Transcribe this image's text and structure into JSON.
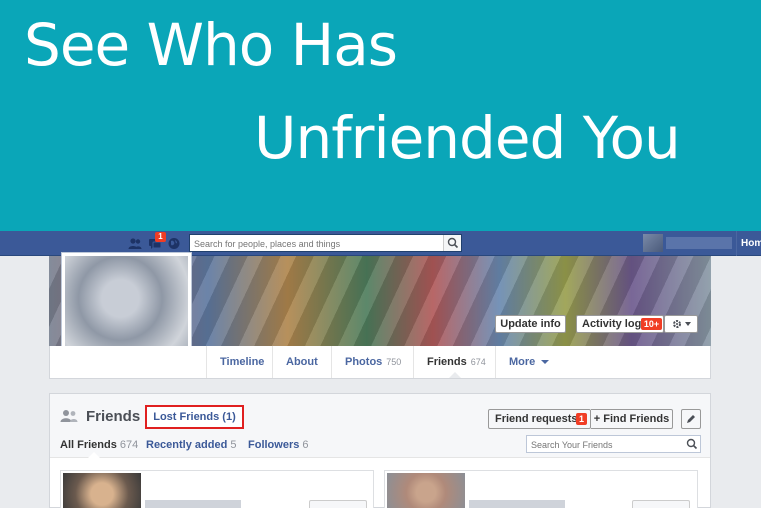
{
  "banner": {
    "line1": "See Who Has",
    "line2": "Unfriended You",
    "color": "#0aa6b8"
  },
  "topbar": {
    "color": "#3b5998",
    "icons": [
      "friend-requests-icon",
      "messages-icon",
      "notifications-globe-icon"
    ],
    "messages_badge": "1",
    "search_placeholder": "Search for people, places and things",
    "home_label": "Home"
  },
  "cover": {
    "update_info_label": "Update info",
    "activity_log_label": "Activity log",
    "activity_badge": "10+",
    "settings_icon": "gear-icon"
  },
  "profile_nav": {
    "tabs": [
      {
        "label": "Timeline",
        "count": ""
      },
      {
        "label": "About",
        "count": ""
      },
      {
        "label": "Photos",
        "count": "750"
      },
      {
        "label": "Friends",
        "count": "674"
      },
      {
        "label": "More",
        "count": ""
      }
    ]
  },
  "friends": {
    "title": "Friends",
    "lost_friends_label": "Lost Friends (1)",
    "friend_requests_label": "Friend requests",
    "friend_requests_badge": "1",
    "find_friends_label": "+ Find Friends",
    "edit_icon": "pencil-icon",
    "subtabs": [
      {
        "label": "All Friends",
        "count": "674"
      },
      {
        "label": "Recently added",
        "count": "5"
      },
      {
        "label": "Followers",
        "count": "6"
      }
    ],
    "search_placeholder": "Search Your Friends",
    "highlight_color": "#e02020"
  }
}
